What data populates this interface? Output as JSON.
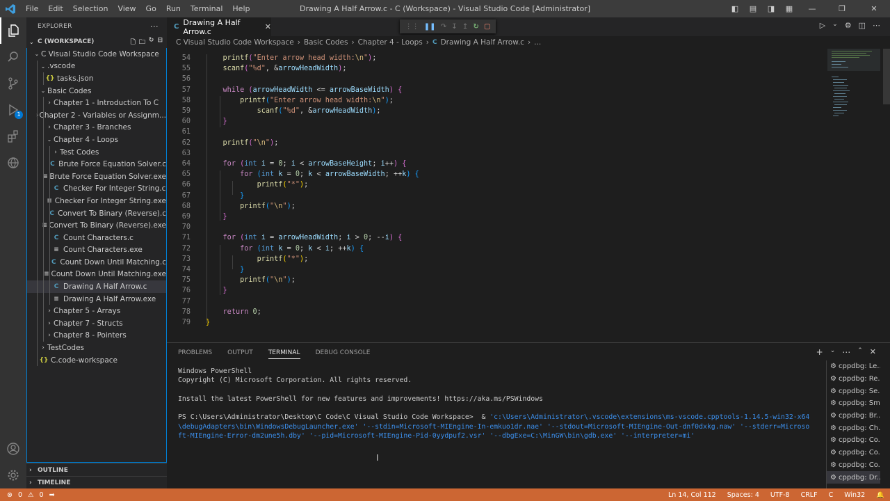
{
  "window": {
    "title": "Drawing A Half Arrow.c - C (Workspace) - Visual Studio Code [Administrator]",
    "menu": [
      "File",
      "Edit",
      "Selection",
      "View",
      "Go",
      "Run",
      "Terminal",
      "Help"
    ]
  },
  "sidebar": {
    "header": "EXPLORER",
    "workspace": "C (WORKSPACE)",
    "tree": [
      {
        "label": "C Visual Studio Code Workspace",
        "type": "folder",
        "open": true,
        "depth": 1
      },
      {
        "label": ".vscode",
        "type": "folder",
        "open": true,
        "depth": 2
      },
      {
        "label": "tasks.json",
        "type": "json",
        "depth": 3
      },
      {
        "label": "Basic Codes",
        "type": "folder",
        "open": true,
        "depth": 2
      },
      {
        "label": "Chapter 1 - Introduction To C",
        "type": "folder",
        "open": false,
        "depth": 3
      },
      {
        "label": "Chapter 2 - Variables or Assignm...",
        "type": "folder",
        "open": false,
        "depth": 3
      },
      {
        "label": "Chapter 3 - Branches",
        "type": "folder",
        "open": false,
        "depth": 3
      },
      {
        "label": "Chapter 4 - Loops",
        "type": "folder",
        "open": true,
        "depth": 3
      },
      {
        "label": "Test Codes",
        "type": "folder",
        "open": false,
        "depth": 4
      },
      {
        "label": "Brute Force Equation Solver.c",
        "type": "c",
        "depth": 4
      },
      {
        "label": "Brute Force Equation Solver.exe",
        "type": "exe",
        "depth": 4
      },
      {
        "label": "Checker For Integer String.c",
        "type": "c",
        "depth": 4
      },
      {
        "label": "Checker For Integer String.exe",
        "type": "exe",
        "depth": 4
      },
      {
        "label": "Convert To Binary (Reverse).c",
        "type": "c",
        "depth": 4
      },
      {
        "label": "Convert To Binary (Reverse).exe",
        "type": "exe",
        "depth": 4
      },
      {
        "label": "Count Characters.c",
        "type": "c",
        "depth": 4
      },
      {
        "label": "Count Characters.exe",
        "type": "exe",
        "depth": 4
      },
      {
        "label": "Count Down Until Matching.c",
        "type": "c",
        "depth": 4
      },
      {
        "label": "Count Down Until Matching.exe",
        "type": "exe",
        "depth": 4
      },
      {
        "label": "Drawing A Half Arrow.c",
        "type": "c",
        "depth": 4
      },
      {
        "label": "Drawing A Half Arrow.exe",
        "type": "exe",
        "depth": 4
      },
      {
        "label": "Chapter 5 - Arrays",
        "type": "folder",
        "open": false,
        "depth": 3
      },
      {
        "label": "Chapter 7 - Structs",
        "type": "folder",
        "open": false,
        "depth": 3
      },
      {
        "label": "Chapter 8 - Pointers",
        "type": "folder",
        "open": false,
        "depth": 3
      },
      {
        "label": "TestCodes",
        "type": "folder",
        "open": false,
        "depth": 2
      },
      {
        "label": "C.code-workspace",
        "type": "json",
        "depth": 2
      }
    ],
    "outline": "OUTLINE",
    "timeline": "TIMELINE"
  },
  "editor": {
    "tab": "Drawing A Half Arrow.c",
    "breadcrumb": [
      "C Visual Studio Code Workspace",
      "Basic Codes",
      "Chapter 4 - Loops",
      "Drawing A Half Arrow.c",
      "..."
    ],
    "line_numbers": [
      "54",
      "55",
      "56",
      "57",
      "58",
      "59",
      "60",
      "61",
      "62",
      "63",
      "64",
      "65",
      "66",
      "67",
      "68",
      "69",
      "70",
      "71",
      "72",
      "73",
      "74",
      "75",
      "76",
      "77",
      "78",
      "79"
    ]
  },
  "panel": {
    "tabs": [
      "PROBLEMS",
      "OUTPUT",
      "TERMINAL",
      "DEBUG CONSOLE"
    ],
    "active_tab": "TERMINAL",
    "terminal_lines": [
      "Windows PowerShell",
      "Copyright (C) Microsoft Corporation. All rights reserved.",
      "",
      "Install the latest PowerShell for new features and improvements! https://aka.ms/PSWindows",
      ""
    ],
    "prompt": "PS C:\\Users\\Administrator\\Desktop\\C Code\\C Visual Studio Code Workspace>  & ",
    "command": "'c:\\Users\\Administrator\\.vscode\\extensions\\ms-vscode.cpptools-1.14.5-win32-x64\\debugAdapters\\bin\\WindowsDebugLauncher.exe' '--stdin=Microsoft-MIEngine-In-emkuo1dr.nae' '--stdout=Microsoft-MIEngine-Out-dnf0dxkg.naw' '--stderr=Microsoft-MIEngine-Error-dm2une5h.dby' '--pid=Microsoft-MIEngine-Pid-0yydpuf2.vsr' '--dbgExe=C:\\MinGW\\bin\\gdb.exe' '--interpreter=mi'",
    "terminal_list": [
      "cppdbg: Le...",
      "cppdbg: Re...",
      "cppdbg: Se...",
      "cppdbg: Sm...",
      "cppdbg: Br...",
      "cppdbg: Ch...",
      "cppdbg: Co...",
      "cppdbg: Co...",
      "cppdbg: Co...",
      "cppdbg: Dr..."
    ]
  },
  "statusbar": {
    "errors": "0",
    "warnings": "0",
    "position": "Ln 14, Col 112",
    "spaces": "Spaces: 4",
    "encoding": "UTF-8",
    "eol": "CRLF",
    "language": "C",
    "platform": "Win32"
  },
  "colors": {
    "statusbar": "#cc6633",
    "accent": "#007fd4",
    "keyword": "#c586c0",
    "type": "#569cd6",
    "function": "#dcdcaa",
    "string": "#ce9178",
    "variable": "#9cdcfe",
    "number": "#b5cea8"
  },
  "icons": [
    "vscode-logo-icon",
    "files-icon",
    "search-icon",
    "source-control-icon",
    "run-debug-icon",
    "extensions-icon",
    "remote-explorer-icon",
    "account-icon",
    "settings-gear-icon"
  ]
}
